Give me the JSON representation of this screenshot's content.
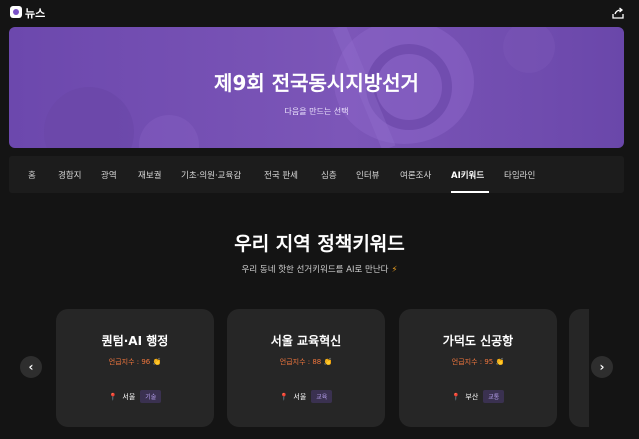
{
  "app": {
    "brand": "뉴스"
  },
  "hero": {
    "title": "제9회 전국동시지방선거",
    "subtitle": "다음을 만드는 선택"
  },
  "nav": {
    "items": [
      {
        "label": "홈"
      },
      {
        "label": "경합지"
      },
      {
        "label": "광역"
      },
      {
        "label": "재보궐"
      },
      {
        "label": "기초·의원·교육감"
      },
      {
        "label": "전국 판세"
      },
      {
        "label": "심층"
      },
      {
        "label": "인터뷰"
      },
      {
        "label": "여론조사"
      },
      {
        "label": "AI키워드",
        "active": true
      },
      {
        "label": "타임라인"
      }
    ]
  },
  "section": {
    "title": "우리 지역 정책키워드",
    "subtitle": "우리 동네 핫한 선거키워드를 AI로 만난다",
    "bolt": "⚡"
  },
  "cards": [
    {
      "title": "퀀텀·AI 행정",
      "metric": "언급지수 : 96 👏",
      "region": "서울",
      "tag": "기술"
    },
    {
      "title": "서울 교육혁신",
      "metric": "언급지수 : 88 👏",
      "region": "서울",
      "tag": "교육"
    },
    {
      "title": "가덕도 신공항",
      "metric": "언급지수 : 95 👏",
      "region": "부산",
      "tag": "교통"
    }
  ],
  "controls": {
    "prev": "‹",
    "next": "›"
  },
  "icons": {
    "logo": "news-logo-icon",
    "share": "share-icon",
    "pin": "location-pin-icon"
  },
  "colors": {
    "accent": "#7c56b8",
    "metric": "#f0763d",
    "tag_bg": "#3a3150",
    "tag_text": "#b8a2f0"
  }
}
